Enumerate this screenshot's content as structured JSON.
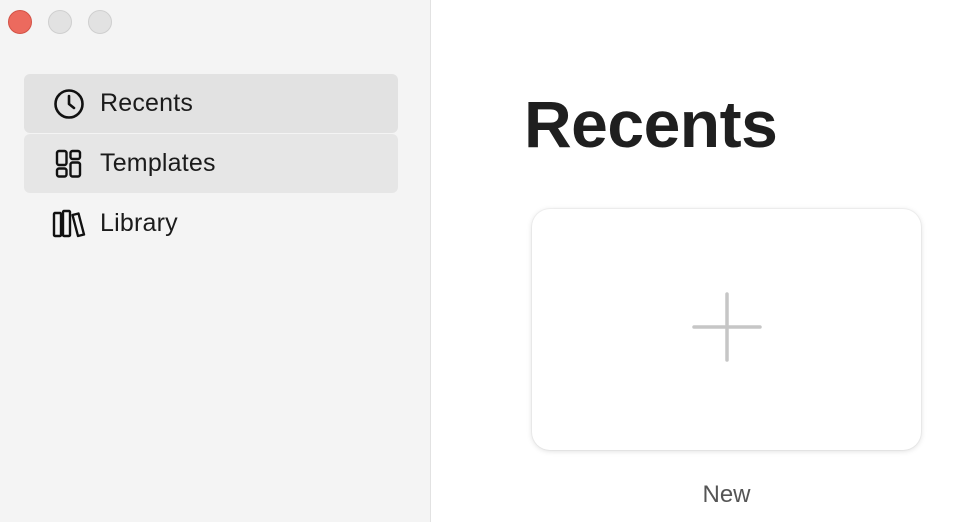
{
  "window": {
    "traffic_lights": [
      "close",
      "minimize",
      "zoom"
    ],
    "close_color": "#ec6a5e"
  },
  "sidebar": {
    "items": [
      {
        "label": "Recents",
        "icon": "clock-icon",
        "active": true
      },
      {
        "label": "Templates",
        "icon": "templates-grid-icon",
        "active": false
      },
      {
        "label": "Library",
        "icon": "library-books-icon",
        "active": false
      }
    ]
  },
  "main": {
    "title": "Recents",
    "new_card": {
      "icon": "plus-icon",
      "label": "New"
    }
  }
}
